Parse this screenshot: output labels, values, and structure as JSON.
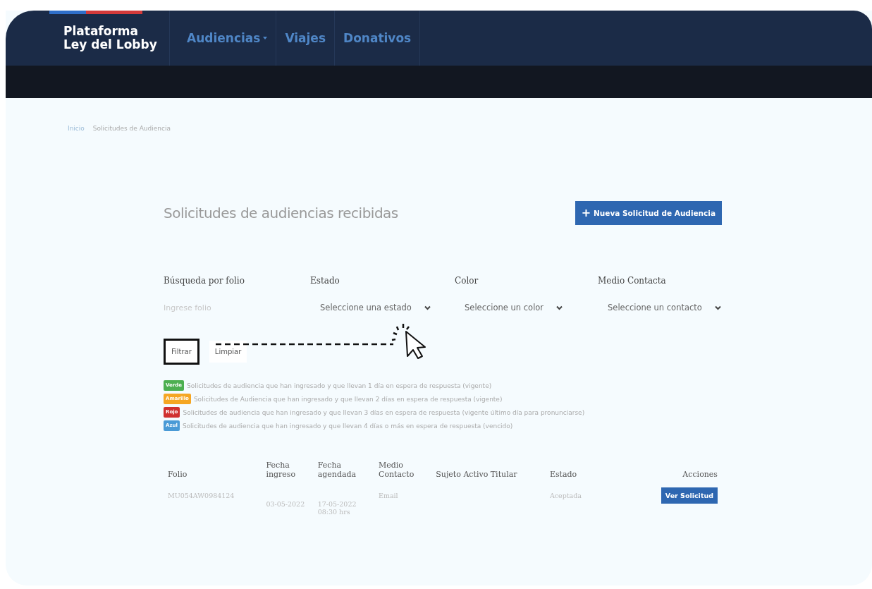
{
  "header": {
    "brand_line_1": "Plataforma",
    "brand_line_2": "Ley del Lobby",
    "nav": [
      {
        "label": "Audiencias",
        "dropdown": true
      },
      {
        "label": "Viajes",
        "dropdown": false
      },
      {
        "label": "Donativos",
        "dropdown": false
      }
    ]
  },
  "breadcrumb": [
    "Inicio",
    "Solicitudes de Audiencia"
  ],
  "title": "Solicitudes de audiencias recibidas",
  "new_button": {
    "icon": "+",
    "label": "Nueva Solicitud de Audiencia"
  },
  "filters": [
    {
      "kind": "input",
      "label": "Búsqueda por folio",
      "placeholder": "Ingrese folio"
    },
    {
      "kind": "select",
      "label": "Estado",
      "value": "Seleccione una estado"
    },
    {
      "kind": "select",
      "label": "Color",
      "value": "Seleccione un color"
    },
    {
      "kind": "select",
      "label": "Medio Contacta",
      "value": "Seleccione un contacto"
    }
  ],
  "actions": [
    {
      "label": "Filtrar",
      "highlighted": true
    },
    {
      "label": "Limpiar",
      "highlighted": false
    }
  ],
  "legend": [
    {
      "badge": "Verde",
      "color": "#4caf50",
      "text": "Solicitudes de audiencia que han ingresado y que llevan 1 día en espera de respuesta (vigente)"
    },
    {
      "badge": "Amarillo",
      "color": "#f5a623",
      "text": "Solicitudes de Audiencia que han ingresado y que llevan 2 días en espera de respuesta (vigente)"
    },
    {
      "badge": "Rojo",
      "color": "#d0302f",
      "text": "Solicitudes de audiencia que han ingresado y que llevan 3 días en espera de respuesta (vigente último día para pronunciarse)"
    },
    {
      "badge": "Azul",
      "color": "#4a9ad6",
      "text": "Solicitudes de audiencia que han ingresado y que llevan 4 días o más en espera de respuesta (vencido)"
    }
  ],
  "table": {
    "columns": [
      "Folio",
      "Fecha ingreso",
      "Fecha agendada",
      "Medio Contacto",
      "Sujeto Activo Titular",
      "Estado",
      "Acciones"
    ],
    "rows": [
      {
        "cells": [
          "MU054AW0984124",
          "03-05-2022",
          "17-05-2022 08:30 hrs",
          "Email",
          "",
          "Aceptada"
        ],
        "action": "Ver Solicitud"
      }
    ]
  }
}
